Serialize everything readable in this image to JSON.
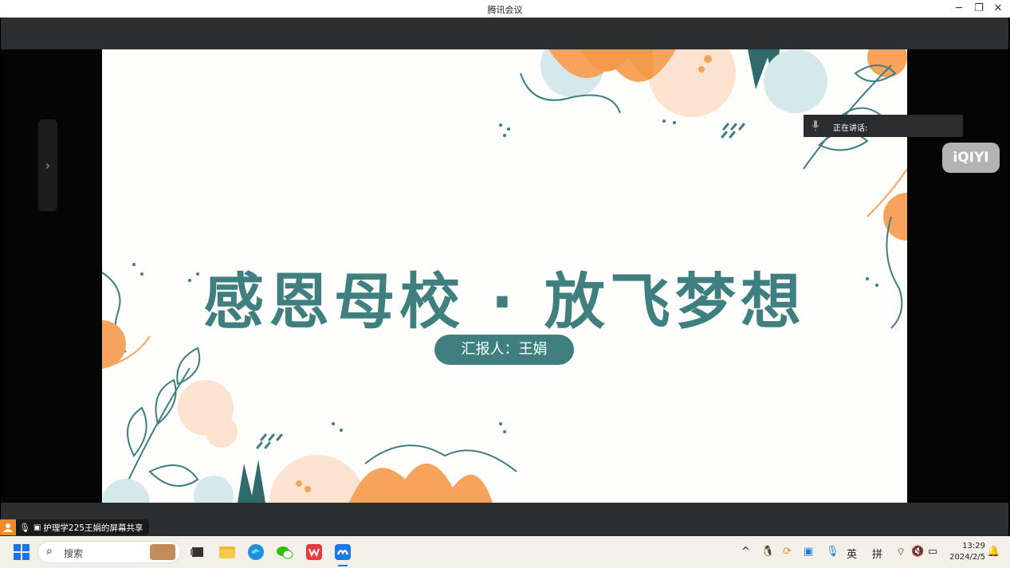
{
  "window": {
    "title": "腾讯会议",
    "minimize_icon": "minimize-icon",
    "restore_icon": "restore-icon",
    "close_icon": "close-icon"
  },
  "slide": {
    "title": "感恩母校 · 放飞梦想",
    "reporter": "汇报人：王娟",
    "colors": {
      "teal": "#3f7f80",
      "orange": "#f7a35c",
      "lightblue": "#d5e9ea"
    }
  },
  "speaking": {
    "label": "正在讲话:"
  },
  "watermark": {
    "text": "iQIYI"
  },
  "share": {
    "label": "护理学225王娟的屏幕共享"
  },
  "taskbar": {
    "search_placeholder": "搜索",
    "tray": {
      "lang1": "英",
      "lang2": "拼"
    },
    "clock": {
      "time": "13:29",
      "date": "2024/2/5"
    }
  }
}
